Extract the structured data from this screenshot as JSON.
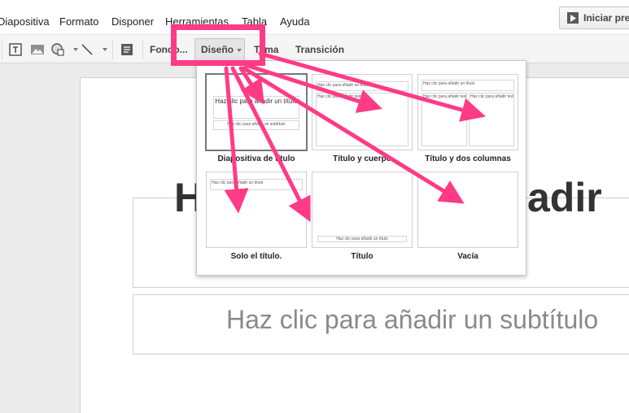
{
  "menubar": {
    "items": [
      "Diapositiva",
      "Formato",
      "Disponer",
      "Herramientas",
      "Tabla",
      "Ayuda"
    ],
    "present_label": "Iniciar pre"
  },
  "toolbar": {
    "icons": [
      "textbox-icon",
      "image-icon",
      "shape-icon",
      "line-icon",
      "comment-icon"
    ],
    "background_label": "Fondo...",
    "layout_label": "Diseño",
    "theme_label": "Tema",
    "transition_label": "Transición"
  },
  "slide": {
    "title_left": "Ha",
    "title_right": "adir",
    "subtitle": "Haz clic para añadir un subtítulo"
  },
  "layouts": [
    {
      "label": "Diapositiva de título",
      "mini_title": "Haz clic para añadir un título",
      "mini_subtitle": "Haz clic para añadir un subtítulo"
    },
    {
      "label": "Título y cuerpo",
      "mini_title": "Haz clic para añadir un título",
      "mini_body": "Haz clic para añadir texto"
    },
    {
      "label": "Título y dos columnas",
      "mini_title": "Haz clic para añadir un título",
      "mini_col1": "Haz clic para añadir texto",
      "mini_col2": "Haz clic para añadir texto"
    },
    {
      "label": "Solo el título.",
      "mini_title": "Haz clic para añadir un título"
    },
    {
      "label": "Título",
      "mini_bottom": "Haz clic para añadir un título"
    },
    {
      "label": "Vacía"
    }
  ],
  "colors": {
    "annotation": "#ff3b86",
    "toolbar_bg": "#f5f5f5",
    "workspace_bg": "#ebebeb"
  }
}
